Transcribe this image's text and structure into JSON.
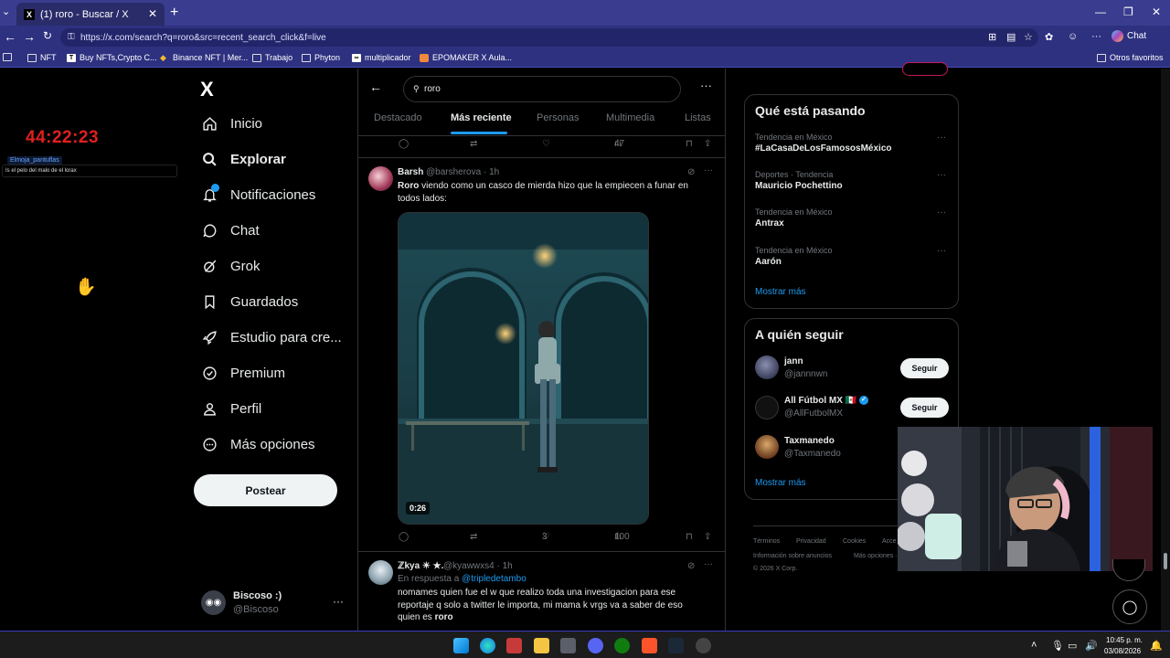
{
  "browser": {
    "tab_title": "(1) roro - Buscar / X",
    "tab_logo": "X",
    "url": "https://x.com/search?q=roro&src=recent_search_click&f=live",
    "copilot_label": "Chat",
    "bookmarks": [
      "NFT",
      "Buy NFTs,Crypto C...",
      "Binance NFT | Mer...",
      "Trabajo",
      "Phyton",
      "multiplicador",
      "EPOMAKER X Aula..."
    ],
    "other_favorites": "Otros favoritos",
    "accent": "#3a3d8f"
  },
  "overlay": {
    "timer": "44:22:23",
    "chat_user": "Elmoja_pantuflas",
    "chat_message": "Is el pelo del malo de el lorax"
  },
  "nav": {
    "logo": "X",
    "items": [
      {
        "label": "Inicio",
        "icon": "home-icon"
      },
      {
        "label": "Explorar",
        "icon": "search-icon"
      },
      {
        "label": "Notificaciones",
        "icon": "bell-icon"
      },
      {
        "label": "Chat",
        "icon": "chat-icon"
      },
      {
        "label": "Grok",
        "icon": "grok-icon"
      },
      {
        "label": "Guardados",
        "icon": "bookmark-icon"
      },
      {
        "label": "Estudio para cre...",
        "icon": "rocket-icon"
      },
      {
        "label": "Premium",
        "icon": "premium-icon"
      },
      {
        "label": "Perfil",
        "icon": "person-icon"
      },
      {
        "label": "Más opciones",
        "icon": "more-circle-icon"
      }
    ],
    "post_button": "Postear",
    "account": {
      "name": "Biscoso :)",
      "handle": "@Biscoso"
    }
  },
  "search": {
    "query": "roro",
    "tabs": [
      "Destacado",
      "Más reciente",
      "Personas",
      "Multimedia",
      "Listas"
    ],
    "active_tab": "Más reciente"
  },
  "tweets": [
    {
      "views": "47"
    },
    {
      "name": "Barsh",
      "meta": "@barsherova · 1h",
      "text_bold": "Roro",
      "text_rest": " viendo como un casco de mierda hizo que la empiecen a funar en todos lados:",
      "video_duration": "0:26",
      "likes": "3",
      "views": "100"
    },
    {
      "name": "ℤkya ☀ ★.",
      "meta": "@kyawwxs4 · 1h",
      "reply_prefix": "En respuesta a ",
      "reply_handle": "@tripledetambo",
      "text_line1": "nomames quien fue el w que realizo toda una investigacion para ese",
      "text_line2": "reportaje q solo a twitter le importa, mi mama k vrgs va a saber de eso",
      "text_line3_prefix": "quien es ",
      "text_line3_bold": "roro"
    }
  ],
  "trends": {
    "title": "Qué está pasando",
    "items": [
      {
        "context": "Tendencia en México",
        "name": "#LaCasaDeLosFamososMéxico"
      },
      {
        "context": "Deportes · Tendencia",
        "name": "Mauricio Pochettino"
      },
      {
        "context": "Tendencia en México",
        "name": "Antrax"
      },
      {
        "context": "Tendencia en México",
        "name": "Aarón"
      }
    ],
    "show_more": "Mostrar más"
  },
  "who_to_follow": {
    "title": "A quién seguir",
    "items": [
      {
        "name": "jann",
        "handle": "@jannnwn",
        "button": "Seguir"
      },
      {
        "name": "All Fútbol MX 🇲🇽",
        "handle": "@AllFutbolMX",
        "button": "Seguir"
      },
      {
        "name": "Taxmanedo",
        "handle": "@Taxmanedo"
      }
    ],
    "show_more": "Mostrar más"
  },
  "footer": {
    "links": [
      "Términos",
      "Privacidad",
      "Cookies",
      "Acce",
      "Información sobre anuncios",
      "Más opciones ···"
    ],
    "copyright": "© 2026 X Corp."
  },
  "taskbar": {
    "time": "10:45 p. m.",
    "date": "03/08/2026"
  }
}
